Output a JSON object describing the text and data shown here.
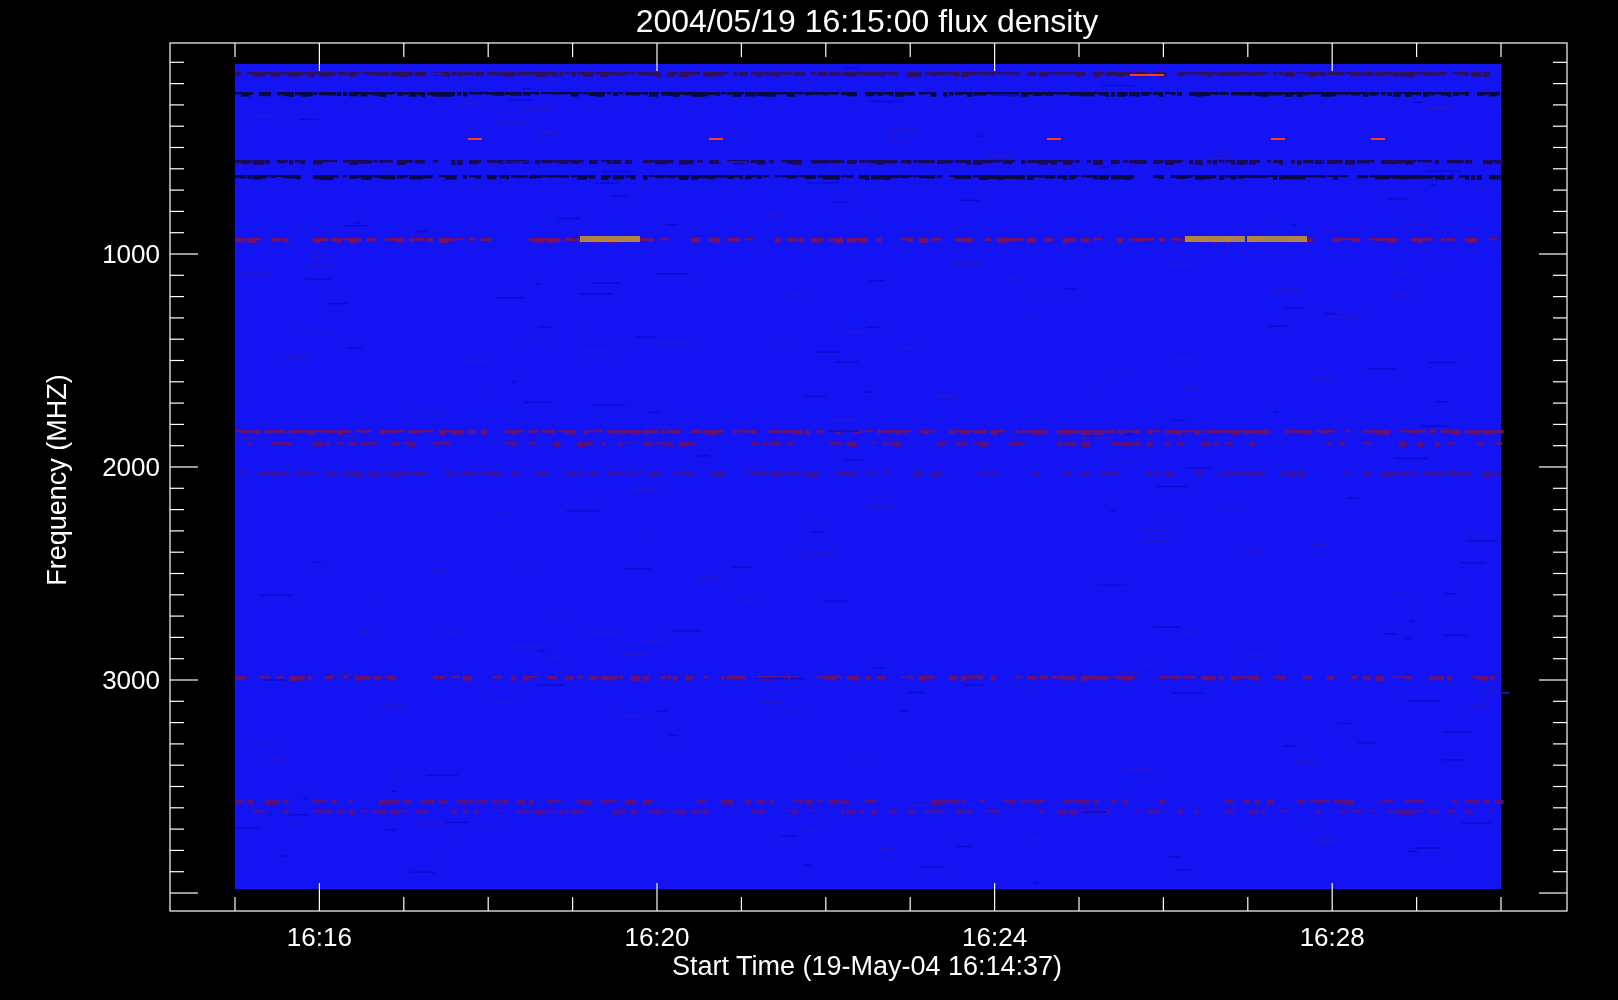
{
  "title": "2004/05/19 16:15:00 flux density",
  "y_axis": {
    "label": "Frequency (MHZ)",
    "ticks": [
      "1000",
      "2000",
      "3000"
    ]
  },
  "x_axis": {
    "label": "Start Time (19-May-04 16:14:37)",
    "ticks": [
      "16:16",
      "16:20",
      "16:24",
      "16:28"
    ]
  }
}
